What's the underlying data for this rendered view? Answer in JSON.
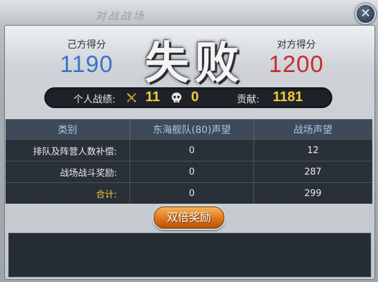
{
  "panel": {
    "title": "对战战场"
  },
  "own": {
    "label": "己方得分",
    "score": "1190"
  },
  "enemy": {
    "label": "对方得分",
    "score": "1200"
  },
  "result": "失败",
  "stats": {
    "personal_label": "个人战绩:",
    "kills": "11",
    "deaths": "0",
    "contribution_label": "贡献:",
    "contribution": "1181"
  },
  "table": {
    "headers": [
      "类别",
      "东海舰队(80)声望",
      "战场声望"
    ],
    "rows": [
      {
        "label": "排队及阵营人数补偿:",
        "fleet": "0",
        "field": "12"
      },
      {
        "label": "战场战斗奖励:",
        "fleet": "0",
        "field": "287"
      },
      {
        "label": "合计:",
        "fleet": "0",
        "field": "299"
      }
    ]
  },
  "bonus_button": "双倍奖励",
  "colors": {
    "own_score": "#3a73c8",
    "enemy_score": "#c62d2d",
    "accent_gold": "#f2cc3a",
    "header_text": "#9fc9f0"
  }
}
